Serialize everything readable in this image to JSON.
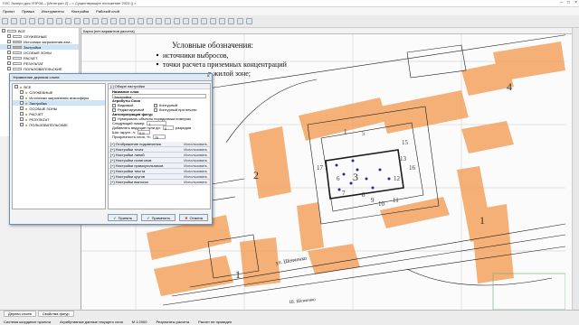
{
  "window": {
    "title": "ГИС Экопро для УПРЗА – [Интеграл 2] – < Существующее положение 2023 () >",
    "controls": [
      "–",
      "□",
      "×"
    ]
  },
  "menu": [
    "Проект",
    "Правка",
    "Инструменты",
    "Настройки",
    "Рабочий слой"
  ],
  "layer_tree": [
    {
      "label": "ВСЕ",
      "color": "#ffffff",
      "level": 0
    },
    {
      "label": "СЛУЖЕБНЫЕ",
      "color": "#ffffff",
      "level": 1
    },
    {
      "label": "Источники загрязнения атм...",
      "color": "#cccccc",
      "level": 1
    },
    {
      "label": "Застройка",
      "color": "#f0a060",
      "level": 1,
      "selected": true
    },
    {
      "label": "ОСОБЫЕ ЗОНЫ",
      "color": "#ffffff",
      "level": 1
    },
    {
      "label": "РАСЧЕТ",
      "color": "#ffffff",
      "level": 1
    },
    {
      "label": "РЕЗУЛЬТАТ",
      "color": "#ffffff",
      "level": 1
    },
    {
      "label": "ПОЛЬЗОВАТЕЛЬСКИЕ",
      "color": "#ffffff",
      "level": 1
    }
  ],
  "map": {
    "header": "Карта (нет вариантов расчета)",
    "legend_title": "Условные обозначения:",
    "legend_items": [
      "источники выбросов,",
      "точки расчета приземных концентраций",
      "в жилой зоне;"
    ],
    "street": "ул. Шевченко",
    "bottom_label": "Ш. Шевченко",
    "numbers": [
      "4",
      "2",
      "3",
      "1",
      "5",
      "6",
      "7",
      "8",
      "9",
      "10",
      "11",
      "12",
      "13",
      "15",
      "16",
      "17",
      "1",
      "1"
    ],
    "colors": {
      "building": "#f4a460",
      "ink": "#1a1a1a",
      "accent": "#2a2a9a"
    }
  },
  "dialog": {
    "title": "Управление деревом слоев",
    "close": "×",
    "tree": [
      {
        "label": "ВСЕ",
        "level": 0
      },
      {
        "label": "СЛУЖЕБНЫЕ",
        "level": 1
      },
      {
        "label": "Источники загрязнения атмосферы",
        "level": 1
      },
      {
        "label": "Застройка",
        "level": 1,
        "selected": true
      },
      {
        "label": "ОСОБЫЕ ЗОНЫ",
        "level": 1
      },
      {
        "label": "РАСЧЕТ",
        "level": 1
      },
      {
        "label": "РЕЗУЛЬТАТ",
        "level": 1
      },
      {
        "label": "ПОЛЬЗОВАТЕЛЬСКИЕ",
        "level": 1
      }
    ],
    "settings": {
      "section_general": "[-] Общие настройки",
      "name_label": "Название слоя",
      "name_value": "Застройка",
      "attrs_label": "Атрибуты Слоя",
      "attr_visible": "Видимый",
      "attr_editable": "Редактируемый",
      "attr_contour": "Контурный",
      "attr_contour_print": "Контурный при печати",
      "auto_numbering_label": "Автонумерация фигур",
      "auto_numbering_opt": "Нумеровать объекты порядковым номером",
      "next_number_label": "Следующий номер:",
      "next_number_value": "1",
      "leading_zero_label": "Добавлять ведущие нули до:",
      "leading_zero_value": "0",
      "leading_zero_unit": "разрядов",
      "grid_step_label": "Шаг округл. л:",
      "grid_step_value": "0.5",
      "transparency_label": "Прозрачность слоя, %:",
      "transparency_value": "70",
      "sections": [
        {
          "label": "[+] Отображение подсвечения",
          "value": "Использовать"
        },
        {
          "label": "[+] Настройки точек",
          "value": "Использовать"
        },
        {
          "label": "[+] Настройки линий",
          "value": "Использовать"
        },
        {
          "label": "[+] Настройки полигонов",
          "value": "Использовать"
        },
        {
          "label": "[+] Настройки прямоугольников",
          "value": "Использовать"
        },
        {
          "label": "[+] Настройки текста",
          "value": "Использовать"
        },
        {
          "label": "[+] Настройки кругов",
          "value": "Использовать"
        },
        {
          "label": "[+] Настройки выносок",
          "value": "Использовать"
        }
      ]
    },
    "buttons": {
      "accept": "Принять",
      "apply": "Применить",
      "cancel": "Отмена"
    }
  },
  "status": {
    "tabs": [
      "Дерево слоев",
      "Свойства фигур"
    ],
    "line": [
      "Система координат проекта",
      "Атрибутивные данные текущего слоя",
      "М 1:2000",
      "Результаты расчета",
      "Расчет не проведен"
    ]
  }
}
